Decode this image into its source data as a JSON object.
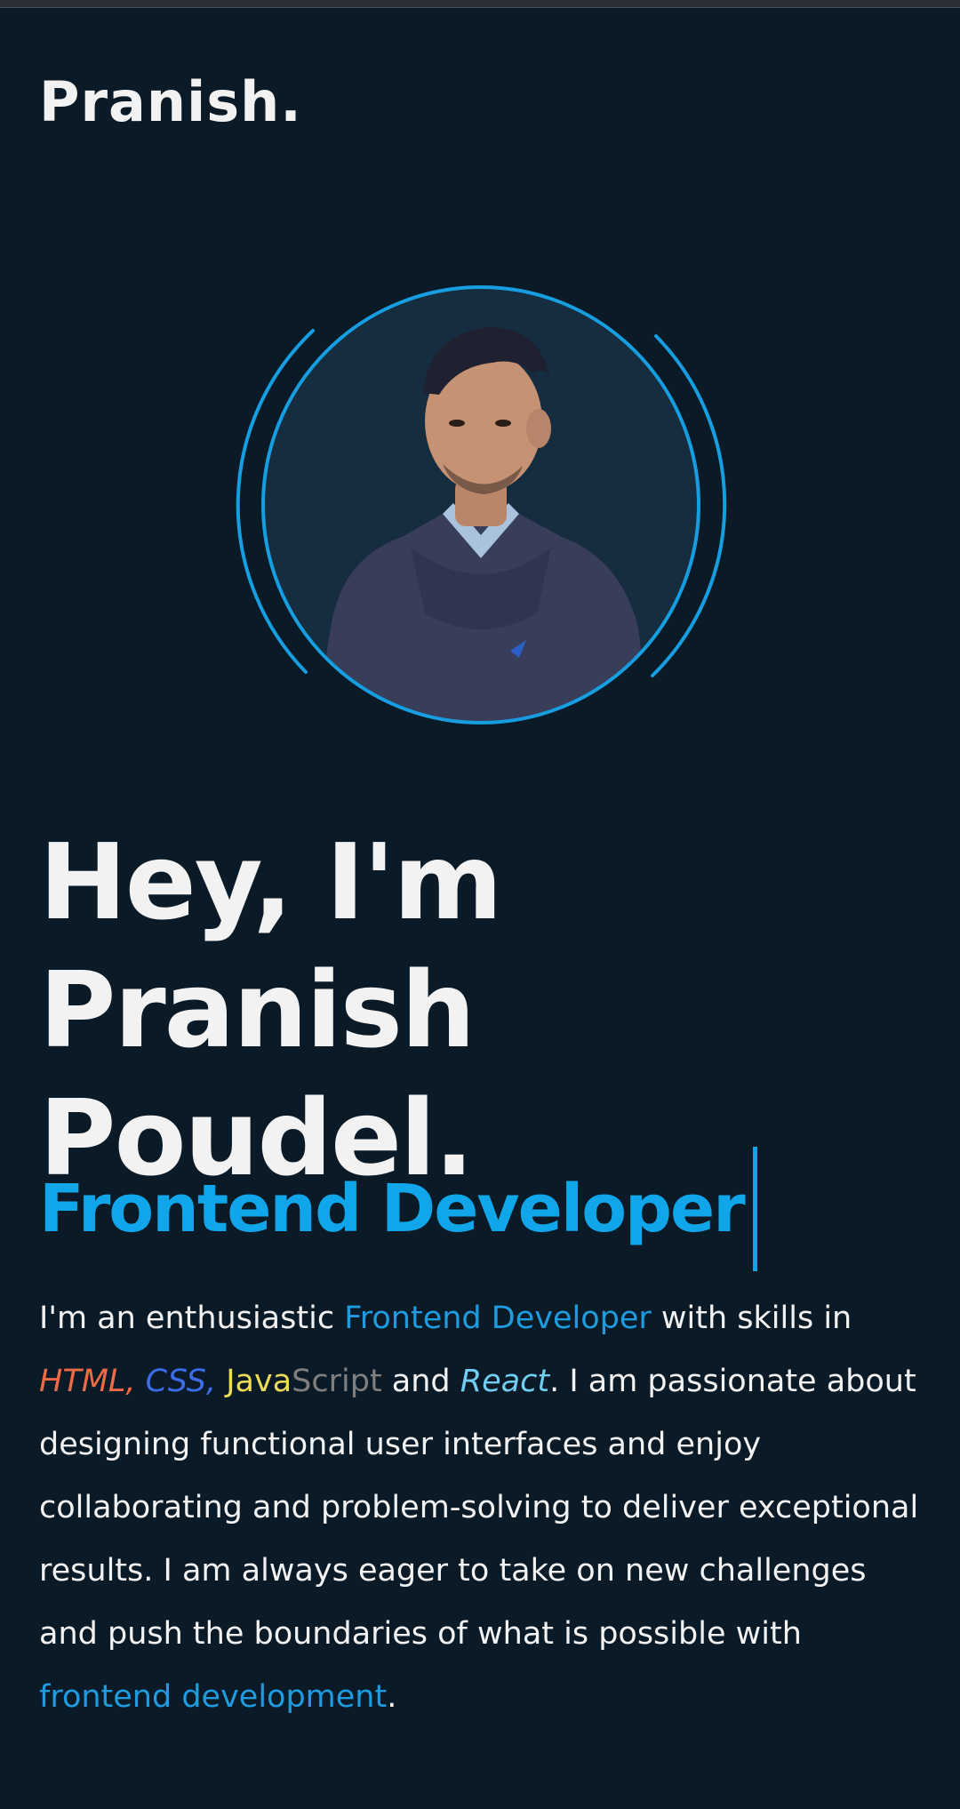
{
  "brand": {
    "logo": "Pranish."
  },
  "hero": {
    "avatar_alt": "Portrait photo",
    "headline_line1": "Hey, I'm Pranish",
    "headline_line2": "Poudel.",
    "role": "Frontend Developer"
  },
  "bio": {
    "p1_a": "I'm an enthusiastic ",
    "p1_link": "Frontend Developer",
    "p1_b": " with skills in",
    "html": "HTML,",
    "css": "CSS,",
    "js_a": "Java",
    "js_b": "Script",
    "p2_and": " and ",
    "react": "React",
    "p2_rest": ". I am passionate about designing functional user interfaces and enjoy collaborating and problem-solving to deliver exceptional results. I am always eager to take on new challenges and push the boundaries of what is possible with ",
    "p3_link": "frontend development",
    "p3_end": "."
  },
  "colors": {
    "background": "#0a1a26",
    "accent": "#11a6ea",
    "html": "#f06a46",
    "css": "#3c6ce8",
    "js": "#eedb55",
    "react": "#71cdf2"
  }
}
